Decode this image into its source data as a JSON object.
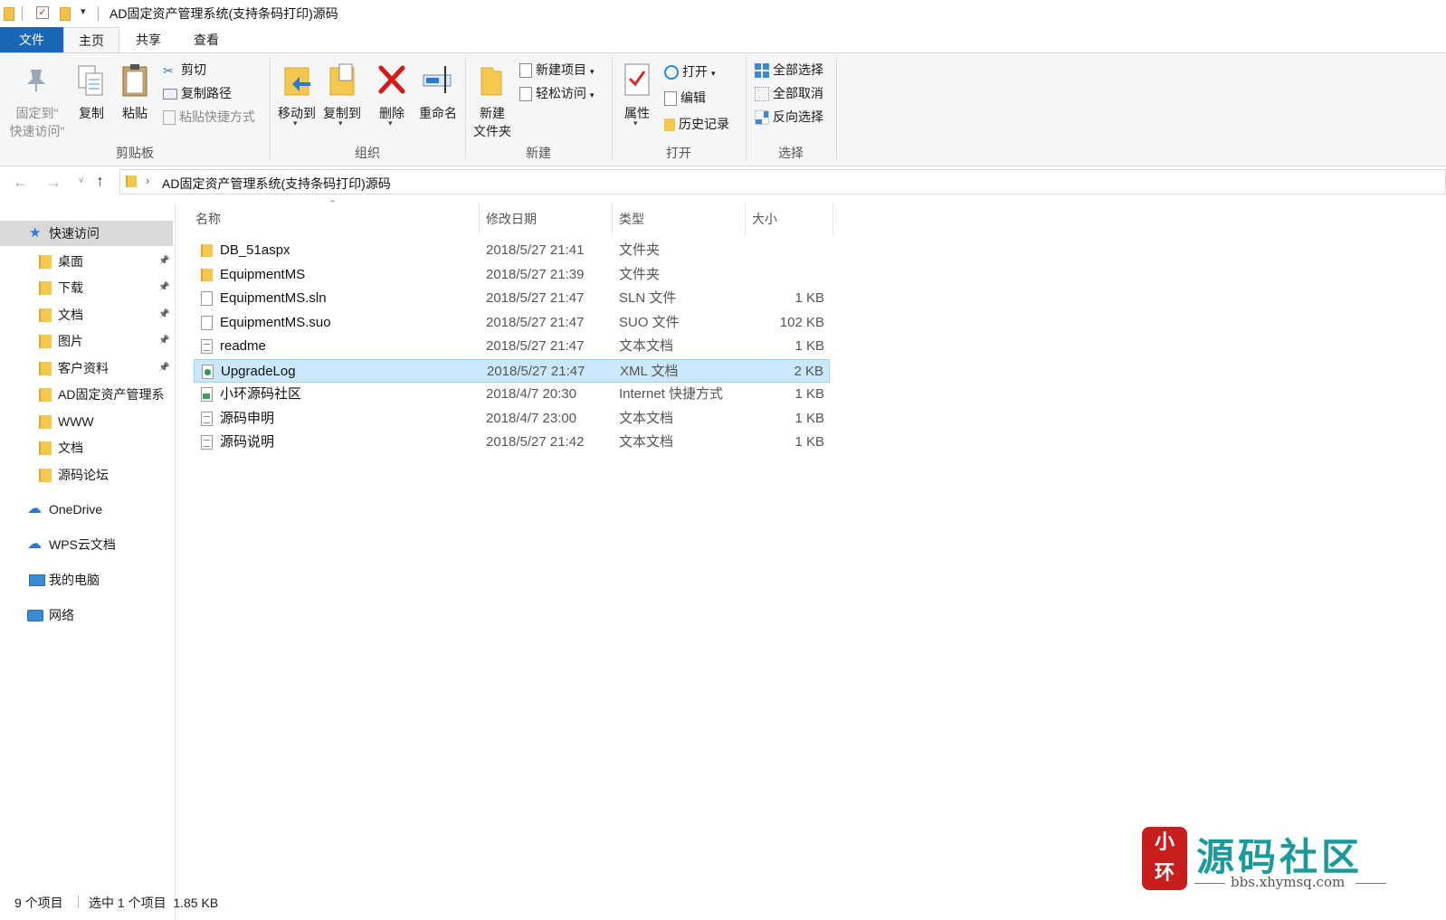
{
  "window": {
    "title": "AD固定资产管理系统(支持条码打印)源码"
  },
  "tabs": [
    {
      "label": "文件"
    },
    {
      "label": "主页"
    },
    {
      "label": "共享"
    },
    {
      "label": "查看"
    }
  ],
  "ribbon": {
    "clipboard": {
      "label": "剪贴板",
      "pin": "固定到\"\n快速访问\"",
      "pin_line1": "固定到\"",
      "pin_line2": "快速访问\"",
      "copy": "复制",
      "paste": "粘贴",
      "cut": "剪切",
      "copy_path": "复制路径",
      "paste_shortcut": "粘贴快捷方式"
    },
    "organize": {
      "label": "组织",
      "move_to": "移动到",
      "copy_to": "复制到",
      "delete": "删除",
      "rename": "重命名"
    },
    "new": {
      "label": "新建",
      "new_folder_line1": "新建",
      "new_folder_line2": "文件夹",
      "new_item": "新建项目",
      "easy_access": "轻松访问"
    },
    "open": {
      "label": "打开",
      "properties": "属性",
      "open": "打开",
      "edit": "编辑",
      "history": "历史记录"
    },
    "select": {
      "label": "选择",
      "select_all": "全部选择",
      "select_none": "全部取消",
      "invert": "反向选择"
    }
  },
  "address": {
    "path": "AD固定资产管理系统(支持条码打印)源码"
  },
  "nav": {
    "quick_access": "快速访问",
    "items": [
      {
        "label": "桌面",
        "pinned": true
      },
      {
        "label": "下载",
        "pinned": true
      },
      {
        "label": "文档",
        "pinned": true
      },
      {
        "label": "图片",
        "pinned": true
      },
      {
        "label": "客户资料",
        "pinned": true
      },
      {
        "label": "AD固定资产管理系",
        "pinned": false
      },
      {
        "label": "WWW",
        "pinned": false
      },
      {
        "label": "文档",
        "pinned": false
      },
      {
        "label": "源码论坛",
        "pinned": false
      }
    ],
    "onedrive": "OneDrive",
    "wps": "WPS云文档",
    "pc": "我的电脑",
    "network": "网络"
  },
  "columns": {
    "name": "名称",
    "date": "修改日期",
    "type": "类型",
    "size": "大小"
  },
  "files": [
    {
      "name": "DB_51aspx",
      "date": "2018/5/27 21:41",
      "type": "文件夹",
      "size": "",
      "icon": "folder"
    },
    {
      "name": "EquipmentMS",
      "date": "2018/5/27 21:39",
      "type": "文件夹",
      "size": "",
      "icon": "folder"
    },
    {
      "name": "EquipmentMS.sln",
      "date": "2018/5/27 21:47",
      "type": "SLN 文件",
      "size": "1 KB",
      "icon": "file"
    },
    {
      "name": "EquipmentMS.suo",
      "date": "2018/5/27 21:47",
      "type": "SUO 文件",
      "size": "102 KB",
      "icon": "file"
    },
    {
      "name": "readme",
      "date": "2018/5/27 21:47",
      "type": "文本文档",
      "size": "1 KB",
      "icon": "txt"
    },
    {
      "name": "UpgradeLog",
      "date": "2018/5/27 21:47",
      "type": "XML 文档",
      "size": "2 KB",
      "icon": "xml",
      "selected": true
    },
    {
      "name": "小环源码社区",
      "date": "2018/4/7 20:30",
      "type": "Internet 快捷方式",
      "size": "1 KB",
      "icon": "url"
    },
    {
      "name": "源码申明",
      "date": "2018/4/7 23:00",
      "type": "文本文档",
      "size": "1 KB",
      "icon": "txt"
    },
    {
      "name": "源码说明",
      "date": "2018/5/27 21:42",
      "type": "文本文档",
      "size": "1 KB",
      "icon": "txt"
    }
  ],
  "status": {
    "count": "9 个项目",
    "selection": "选中 1 个项目  1.85 KB"
  },
  "watermark": {
    "seal": "小\n环",
    "seal_top": "小",
    "seal_bottom": "环",
    "title": "源码社区",
    "url": "bbs.xhymsq.com"
  },
  "colors": {
    "accent": "#1a66b8",
    "selection": "#cce8ff",
    "selection_border": "#99d1ff",
    "folder": "#f4c84f",
    "watermark_teal": "#1a9a9a",
    "watermark_red": "#c81e1e"
  }
}
